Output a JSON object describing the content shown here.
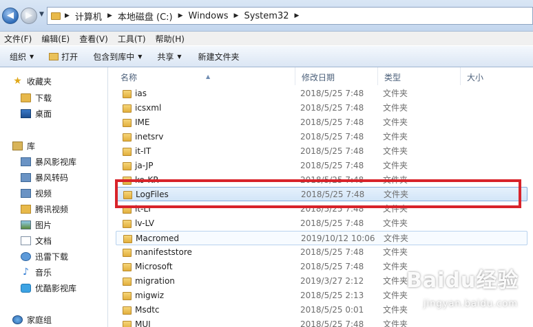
{
  "address": {
    "crumbs": [
      "计算机",
      "本地磁盘 (C:)",
      "Windows",
      "System32"
    ]
  },
  "menu": [
    "文件(F)",
    "编辑(E)",
    "查看(V)",
    "工具(T)",
    "帮助(H)"
  ],
  "toolbar": {
    "organize": "组织",
    "open": "打开",
    "include_library": "包含到库中",
    "share": "共享",
    "new_folder": "新建文件夹"
  },
  "sidebar": {
    "favorites": "收藏夹",
    "downloads": "下载",
    "desktop": "桌面",
    "libraries": "库",
    "lib_items": [
      "暴风影视库",
      "暴风转码",
      "视频",
      "腾讯视频",
      "图片",
      "文档",
      "迅雷下载",
      "音乐",
      "优酷影视库"
    ],
    "homegroup": "家庭组"
  },
  "columns": {
    "name": "名称",
    "date": "修改日期",
    "type": "类型",
    "size": "大小"
  },
  "files": [
    {
      "name": "ias",
      "date": "2018/5/25 7:48",
      "type": "文件夹"
    },
    {
      "name": "icsxml",
      "date": "2018/5/25 7:48",
      "type": "文件夹"
    },
    {
      "name": "IME",
      "date": "2018/5/25 7:48",
      "type": "文件夹"
    },
    {
      "name": "inetsrv",
      "date": "2018/5/25 7:48",
      "type": "文件夹"
    },
    {
      "name": "it-IT",
      "date": "2018/5/25 7:48",
      "type": "文件夹"
    },
    {
      "name": "ja-JP",
      "date": "2018/5/25 7:48",
      "type": "文件夹"
    },
    {
      "name": "ko-KR",
      "date": "2018/5/25 7:48",
      "type": "文件夹"
    },
    {
      "name": "LogFiles",
      "date": "2018/5/25 7:48",
      "type": "文件夹"
    },
    {
      "name": "lt-LT",
      "date": "2018/5/25 7:48",
      "type": "文件夹"
    },
    {
      "name": "lv-LV",
      "date": "2018/5/25 7:48",
      "type": "文件夹"
    },
    {
      "name": "Macromed",
      "date": "2019/10/12 10:06",
      "type": "文件夹"
    },
    {
      "name": "manifeststore",
      "date": "2018/5/25 7:48",
      "type": "文件夹"
    },
    {
      "name": "Microsoft",
      "date": "2018/5/25 7:48",
      "type": "文件夹"
    },
    {
      "name": "migration",
      "date": "2019/3/27 2:12",
      "type": "文件夹"
    },
    {
      "name": "migwiz",
      "date": "2018/5/25 2:13",
      "type": "文件夹"
    },
    {
      "name": "Msdtc",
      "date": "2018/5/25 0:01",
      "type": "文件夹"
    },
    {
      "name": "MUI",
      "date": "2018/5/25 7:48",
      "type": "文件夹"
    }
  ],
  "watermark": {
    "brand": "Baidu经验",
    "sub": "jingyan.baidu.com"
  },
  "colors": {
    "highlight_box": "#d8232a",
    "selection": "#d2e5f8"
  }
}
